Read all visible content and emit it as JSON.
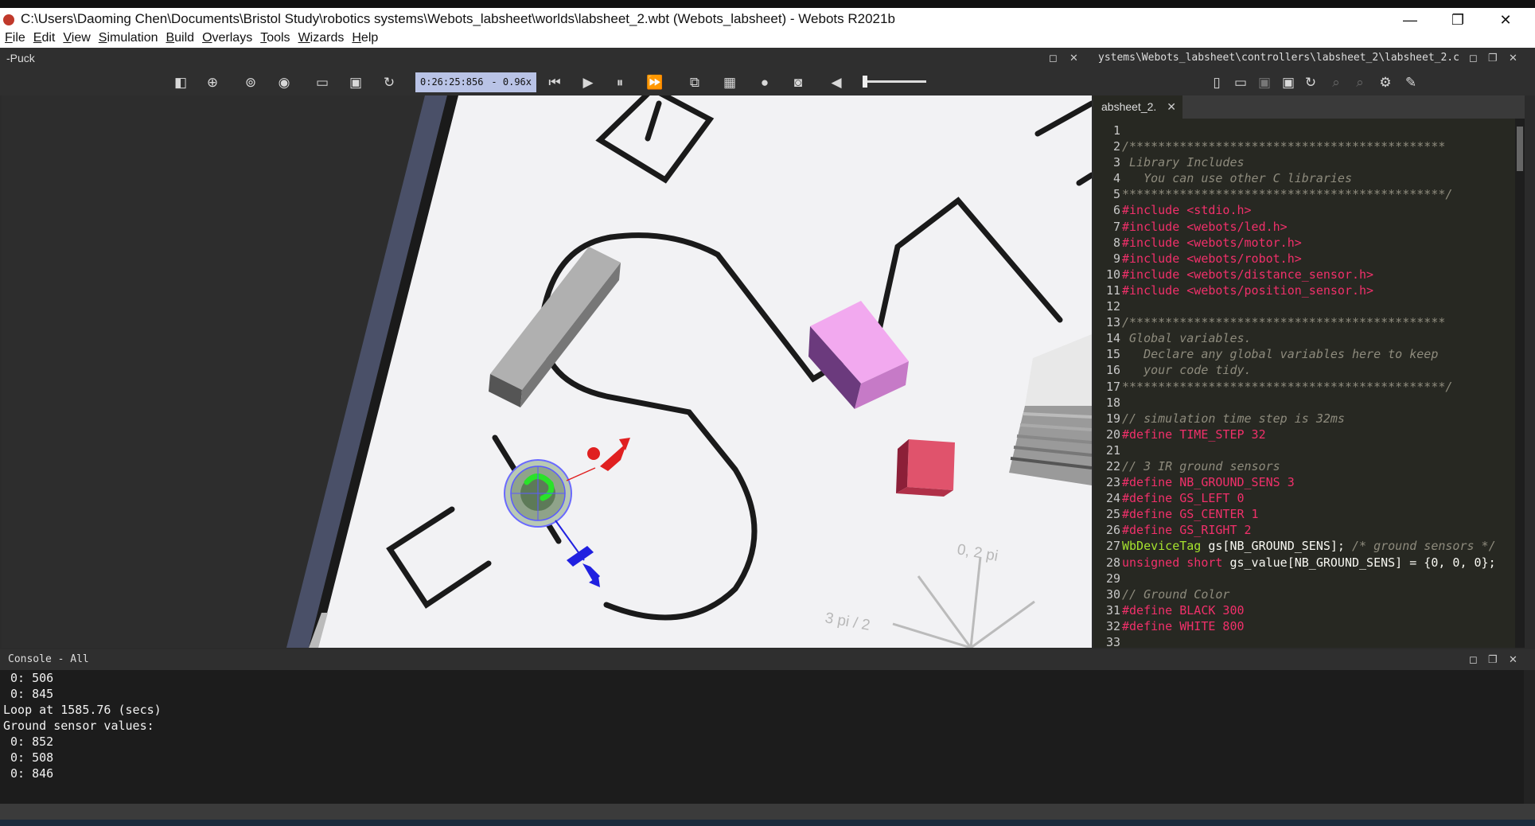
{
  "window": {
    "title": "C:\\Users\\Daoming Chen\\Documents\\Bristol Study\\robotics systems\\Webots_labsheet\\worlds\\labsheet_2.wbt (Webots_labsheet) - Webots R2021b",
    "min": "—",
    "max": "❐",
    "close": "✕"
  },
  "menu": [
    "File",
    "Edit",
    "View",
    "Simulation",
    "Build",
    "Overlays",
    "Tools",
    "Wizards",
    "Help"
  ],
  "scene_panel": {
    "label": "-Puck",
    "btn_float": "◻",
    "btn_close": "✕"
  },
  "editor_panel": {
    "path": "ystems\\Webots_labsheet\\controllers\\labsheet_2\\labsheet_2.c",
    "btn_float": "◻",
    "btn_dock": "❐",
    "btn_close": "✕"
  },
  "toolbar": {
    "time": "0:26:25:856",
    "speed": "- 0.96x"
  },
  "viewport": {
    "label_a": "0, 2 pi",
    "label_b": "3 pi / 2",
    "colors": {
      "floor": "#f2f2f4",
      "line": "#1a1a1a",
      "pink_box": "#f2a9ef",
      "red_box": "#e0536c",
      "grey_box": "#a9a9a9"
    }
  },
  "editor_tab": {
    "label": "absheet_2.",
    "close": "✕"
  },
  "code_lines": [
    {
      "n": "1",
      "parts": []
    },
    {
      "n": "2",
      "parts": [
        {
          "c": "c-com",
          "t": "/********************************************"
        }
      ]
    },
    {
      "n": "3",
      "parts": [
        {
          "c": "c-com",
          "t": " Library Includes"
        }
      ]
    },
    {
      "n": "4",
      "parts": [
        {
          "c": "c-com",
          "t": "   You can use other C libraries"
        }
      ]
    },
    {
      "n": "5",
      "parts": [
        {
          "c": "c-com",
          "t": "*********************************************/"
        }
      ]
    },
    {
      "n": "6",
      "parts": [
        {
          "c": "c-pre",
          "t": "#include <stdio.h>"
        }
      ]
    },
    {
      "n": "7",
      "parts": [
        {
          "c": "c-pre",
          "t": "#include <webots/led.h>"
        }
      ]
    },
    {
      "n": "8",
      "parts": [
        {
          "c": "c-pre",
          "t": "#include <webots/motor.h>"
        }
      ]
    },
    {
      "n": "9",
      "parts": [
        {
          "c": "c-pre",
          "t": "#include <webots/robot.h>"
        }
      ]
    },
    {
      "n": "10",
      "parts": [
        {
          "c": "c-pre",
          "t": "#include <webots/distance_sensor.h>"
        }
      ]
    },
    {
      "n": "11",
      "parts": [
        {
          "c": "c-pre",
          "t": "#include <webots/position_sensor.h>"
        }
      ]
    },
    {
      "n": "12",
      "parts": []
    },
    {
      "n": "13",
      "parts": [
        {
          "c": "c-com",
          "t": "/********************************************"
        }
      ]
    },
    {
      "n": "14",
      "parts": [
        {
          "c": "c-com",
          "t": " Global variables."
        }
      ]
    },
    {
      "n": "15",
      "parts": [
        {
          "c": "c-com",
          "t": "   Declare any global variables here to keep"
        }
      ]
    },
    {
      "n": "16",
      "parts": [
        {
          "c": "c-com",
          "t": "   your code tidy."
        }
      ]
    },
    {
      "n": "17",
      "parts": [
        {
          "c": "c-com",
          "t": "*********************************************/"
        }
      ]
    },
    {
      "n": "18",
      "parts": []
    },
    {
      "n": "19",
      "parts": [
        {
          "c": "c-com",
          "t": "// simulation time step is 32ms"
        }
      ]
    },
    {
      "n": "20",
      "parts": [
        {
          "c": "c-pre",
          "t": "#define TIME_STEP 32"
        }
      ]
    },
    {
      "n": "21",
      "parts": []
    },
    {
      "n": "22",
      "parts": [
        {
          "c": "c-com",
          "t": "// 3 IR ground sensors"
        }
      ]
    },
    {
      "n": "23",
      "parts": [
        {
          "c": "c-pre",
          "t": "#define NB_GROUND_SENS 3"
        }
      ]
    },
    {
      "n": "24",
      "parts": [
        {
          "c": "c-pre",
          "t": "#define GS_LEFT 0"
        }
      ]
    },
    {
      "n": "25",
      "parts": [
        {
          "c": "c-pre",
          "t": "#define GS_CENTER 1"
        }
      ]
    },
    {
      "n": "26",
      "parts": [
        {
          "c": "c-pre",
          "t": "#define GS_RIGHT 2"
        }
      ]
    },
    {
      "n": "27",
      "parts": [
        {
          "c": "c-type",
          "t": "WbDeviceTag"
        },
        {
          "c": "c-txt",
          "t": " gs[NB_GROUND_SENS]; "
        },
        {
          "c": "c-com",
          "t": "/* ground sensors */"
        }
      ]
    },
    {
      "n": "28",
      "parts": [
        {
          "c": "c-kw",
          "t": "unsigned short"
        },
        {
          "c": "c-txt",
          "t": " gs_value[NB_GROUND_SENS] = {0, 0, 0};"
        }
      ]
    },
    {
      "n": "29",
      "parts": []
    },
    {
      "n": "30",
      "parts": [
        {
          "c": "c-com",
          "t": "// Ground Color"
        }
      ]
    },
    {
      "n": "31",
      "parts": [
        {
          "c": "c-pre",
          "t": "#define BLACK 300"
        }
      ]
    },
    {
      "n": "32",
      "parts": [
        {
          "c": "c-pre",
          "t": "#define WHITE 800"
        }
      ]
    },
    {
      "n": "33",
      "parts": []
    }
  ],
  "console": {
    "label": "Console - All",
    "lines": [
      " 0: 506",
      " 0: 845",
      "Loop at 1585.76 (secs)",
      "Ground sensor values:",
      " 0: 852",
      " 0: 508",
      " 0: 846"
    ]
  }
}
